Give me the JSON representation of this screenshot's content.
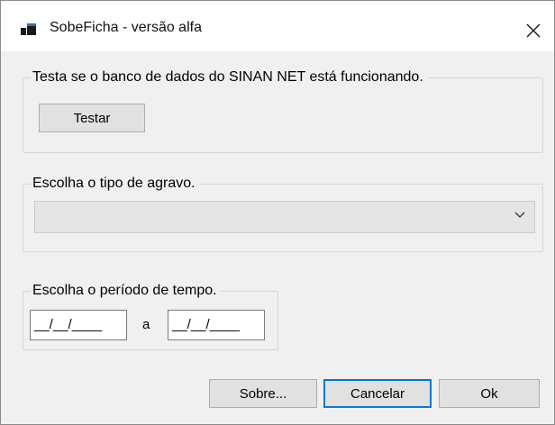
{
  "window": {
    "title": "SobeFicha - versão alfa",
    "icons": {
      "app": "app-window-icon",
      "close": "close-icon"
    }
  },
  "test_group": {
    "label": "Testa se o banco de dados do SINAN NET está funcionando.",
    "button_label": "Testar"
  },
  "agravo_group": {
    "label": "Escolha o tipo de agravo.",
    "select_value": "",
    "icon": "chevron-down-icon"
  },
  "period_group": {
    "label": "Escolha o período de tempo.",
    "start_date": "__/__/____",
    "separator": "a",
    "end_date": "__/__/____"
  },
  "footer": {
    "about_label": "Sobre...",
    "cancel_label": "Cancelar",
    "ok_label": "Ok"
  },
  "colors": {
    "default_button_border": "#0078d7",
    "dialog_background": "#f0f0f0"
  }
}
